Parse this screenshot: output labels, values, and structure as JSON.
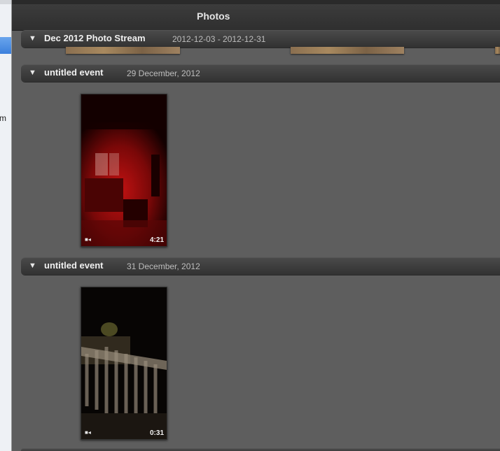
{
  "window": {
    "title": "Photos"
  },
  "sidebar": {
    "fragment_text": "m"
  },
  "events": [
    {
      "name": "Dec 2012 Photo Stream",
      "dates": "2012-12-03 - 2012-12-31"
    },
    {
      "name": "untitled event",
      "dates": "29 December, 2012",
      "items": [
        {
          "kind": "video",
          "duration": "4:21"
        }
      ]
    },
    {
      "name": "untitled event",
      "dates": "31 December, 2012",
      "items": [
        {
          "kind": "video",
          "duration": "0:31"
        }
      ]
    }
  ],
  "icons": {
    "disclosure": "disclosure-triangle-icon",
    "video": "video-camera-icon"
  },
  "colors": {
    "background": "#5e5e5e",
    "header": "#3a3a3a",
    "selection": "#3b80dc"
  }
}
